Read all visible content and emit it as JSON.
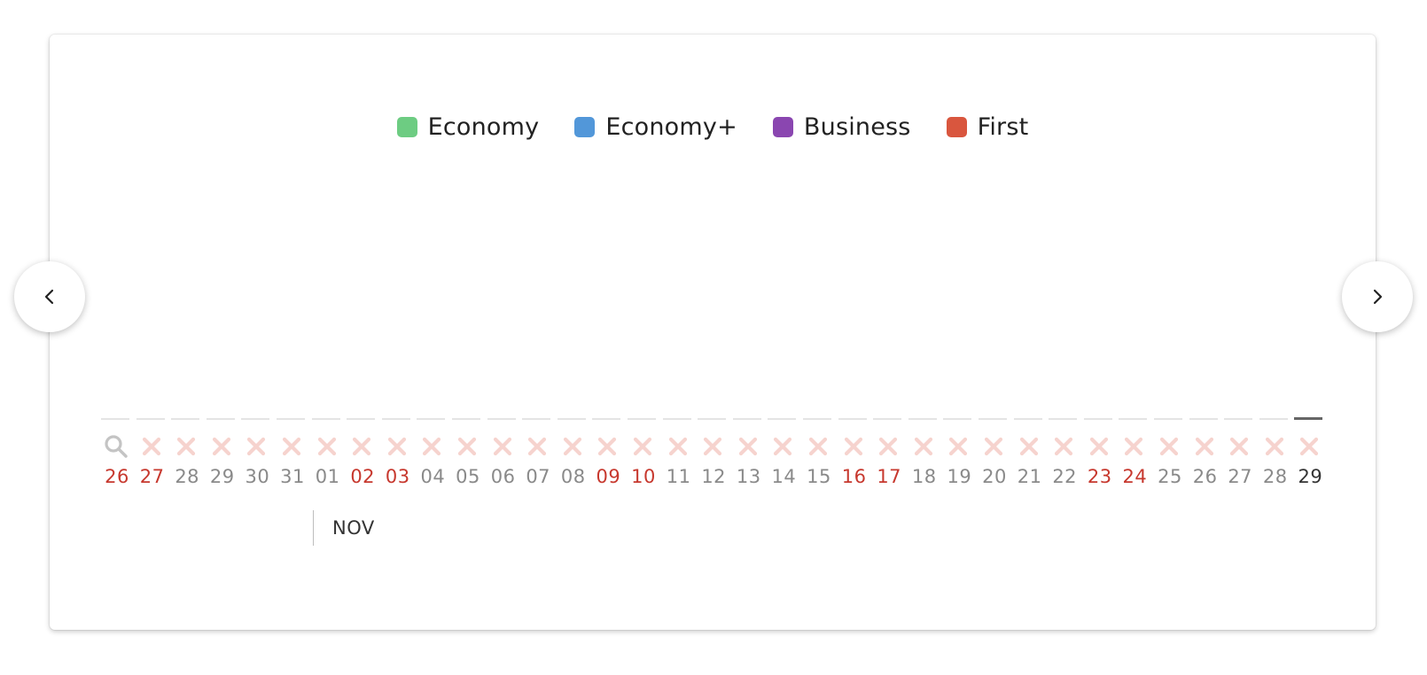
{
  "legend": [
    {
      "label": "Economy",
      "color": "#6dcc82"
    },
    {
      "label": "Economy+",
      "color": "#5297d9"
    },
    {
      "label": "Business",
      "color": "#8a46b0"
    },
    {
      "label": "First",
      "color": "#d9563e"
    }
  ],
  "calendar": {
    "month_label": "NOV",
    "days": [
      {
        "day": "26",
        "weekend": true,
        "status": "search"
      },
      {
        "day": "27",
        "weekend": true,
        "status": "unavailable"
      },
      {
        "day": "28",
        "weekend": false,
        "status": "unavailable"
      },
      {
        "day": "29",
        "weekend": false,
        "status": "unavailable"
      },
      {
        "day": "30",
        "weekend": false,
        "status": "unavailable"
      },
      {
        "day": "31",
        "weekend": false,
        "status": "unavailable"
      },
      {
        "day": "01",
        "weekend": false,
        "status": "unavailable"
      },
      {
        "day": "02",
        "weekend": true,
        "status": "unavailable"
      },
      {
        "day": "03",
        "weekend": true,
        "status": "unavailable"
      },
      {
        "day": "04",
        "weekend": false,
        "status": "unavailable"
      },
      {
        "day": "05",
        "weekend": false,
        "status": "unavailable"
      },
      {
        "day": "06",
        "weekend": false,
        "status": "unavailable"
      },
      {
        "day": "07",
        "weekend": false,
        "status": "unavailable"
      },
      {
        "day": "08",
        "weekend": false,
        "status": "unavailable"
      },
      {
        "day": "09",
        "weekend": true,
        "status": "unavailable"
      },
      {
        "day": "10",
        "weekend": true,
        "status": "unavailable"
      },
      {
        "day": "11",
        "weekend": false,
        "status": "unavailable"
      },
      {
        "day": "12",
        "weekend": false,
        "status": "unavailable"
      },
      {
        "day": "13",
        "weekend": false,
        "status": "unavailable"
      },
      {
        "day": "14",
        "weekend": false,
        "status": "unavailable"
      },
      {
        "day": "15",
        "weekend": false,
        "status": "unavailable"
      },
      {
        "day": "16",
        "weekend": true,
        "status": "unavailable"
      },
      {
        "day": "17",
        "weekend": true,
        "status": "unavailable"
      },
      {
        "day": "18",
        "weekend": false,
        "status": "unavailable"
      },
      {
        "day": "19",
        "weekend": false,
        "status": "unavailable"
      },
      {
        "day": "20",
        "weekend": false,
        "status": "unavailable"
      },
      {
        "day": "21",
        "weekend": false,
        "status": "unavailable"
      },
      {
        "day": "22",
        "weekend": false,
        "status": "unavailable"
      },
      {
        "day": "23",
        "weekend": true,
        "status": "unavailable"
      },
      {
        "day": "24",
        "weekend": true,
        "status": "unavailable"
      },
      {
        "day": "25",
        "weekend": false,
        "status": "unavailable"
      },
      {
        "day": "26",
        "weekend": false,
        "status": "unavailable"
      },
      {
        "day": "27",
        "weekend": false,
        "status": "unavailable"
      },
      {
        "day": "28",
        "weekend": false,
        "status": "unavailable"
      },
      {
        "day": "29",
        "weekend": false,
        "status": "unavailable",
        "current": true
      }
    ]
  },
  "navigation": {
    "prev_icon": "chevron-left-icon",
    "next_icon": "chevron-right-icon"
  },
  "colors": {
    "weekend_text": "#c7382e",
    "weekday_text": "#8a8a8a",
    "unavailable_mark": "#f6d3ce",
    "search_icon": "#c4c4c4"
  }
}
